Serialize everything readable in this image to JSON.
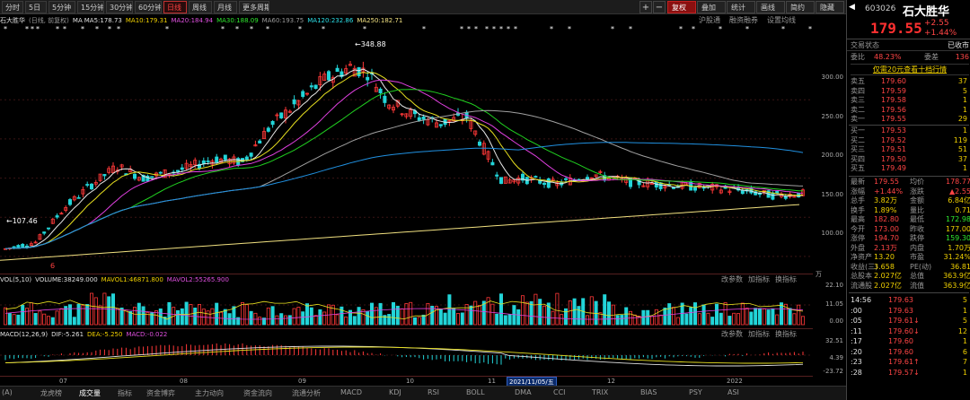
{
  "colors": {
    "up": "#ff3838",
    "down": "#22d4d8",
    "ma5": "#e8e8e8",
    "ma10": "#e8e020",
    "ma20": "#e040e0",
    "ma30": "#20d020",
    "ma60": "#a0a0a0",
    "ma120": "#2090e0",
    "ma250": "#f0e080"
  },
  "toolbar": {
    "periods": [
      "分时",
      "5日",
      "5分钟",
      "15分钟",
      "30分钟",
      "60分钟",
      "日线",
      "周线",
      "月线",
      "更多周期"
    ],
    "active_period": "日线",
    "right": [
      "复权",
      "叠加",
      "统计",
      "画线",
      "简约",
      "隐藏"
    ],
    "active_right": "复权"
  },
  "ma_bar": {
    "title": "石大胜华",
    "sub": "(日线, 前复权)",
    "ma5": "MA5:178.73",
    "ma10": "MA10:179.31",
    "ma20": "MA20:184.94",
    "ma30": "MA30:188.09",
    "ma60": "MA60:193.75",
    "ma120": "MA120:232.86",
    "ma250": "MA250:182.71",
    "links": [
      "沪股通",
      "融资融券",
      "设置均线"
    ]
  },
  "price_chart": {
    "y_ticks": [
      "300.00",
      "250.00",
      "200.00",
      "150.00",
      "100.00"
    ],
    "y_values": [
      300,
      250,
      200,
      150,
      100
    ],
    "high_label": "348.88",
    "low_label": "107.46",
    "ymin": 85,
    "ymax": 385,
    "marker": "6"
  },
  "vol_bar": {
    "title": "VOL(5,10)",
    "volume": "VOLUME:38249.000",
    "mavol1": "MAVOL1:46871.800",
    "mavol2": "MAVOL2:55265.900",
    "links": [
      "改参数",
      "加指标",
      "换指标"
    ],
    "y_ticks": [
      "22.10",
      "11.05",
      "0.00"
    ],
    "unit": "万"
  },
  "macd_bar": {
    "title": "MACD(12,26,9)",
    "dif": "DIF:-5.261",
    "dea": "DEA:-5.250",
    "macd": "MACD:-0.022",
    "links": [
      "改参数",
      "加指标",
      "换指标"
    ],
    "y_ticks": [
      "32.51",
      "4.39",
      "-23.72"
    ]
  },
  "x_axis": {
    "months": [
      "07",
      "08",
      "09",
      "10",
      "11",
      "12",
      "2022"
    ],
    "hover_date": "2021/11/05/五"
  },
  "bottom_tabs": [
    "(A)",
    "龙虎榜",
    "成交量",
    "指标",
    "资金博弈",
    "主力动向",
    "资金流向",
    "流通分析",
    "MACD",
    "KDJ",
    "RSI",
    "BOLL",
    "DMA",
    "CCI",
    "TRIX",
    "BIAS",
    "PSY",
    "ASI"
  ],
  "quote": {
    "code": "603026",
    "name": "石大胜华",
    "price": "179.55",
    "change": "+2.55",
    "change_pct": "+1.44%",
    "trade_status_label": "交易状态",
    "trade_status_value": "已收市",
    "ratio_label": "委比",
    "ratio_value": "48.23%",
    "diff_label": "委差",
    "diff_value": "136",
    "level10": "仅需20元查看十档行情",
    "asks": [
      {
        "label": "卖五",
        "price": "179.60",
        "vol": "37"
      },
      {
        "label": "卖四",
        "price": "179.59",
        "vol": "5"
      },
      {
        "label": "卖三",
        "price": "179.58",
        "vol": "1"
      },
      {
        "label": "卖二",
        "price": "179.56",
        "vol": "1"
      },
      {
        "label": "卖一",
        "price": "179.55",
        "vol": "29"
      }
    ],
    "bids": [
      {
        "label": "买一",
        "price": "179.53",
        "vol": "1"
      },
      {
        "label": "买二",
        "price": "179.52",
        "vol": "119"
      },
      {
        "label": "买三",
        "price": "179.51",
        "vol": "51"
      },
      {
        "label": "买四",
        "price": "179.50",
        "vol": "37"
      },
      {
        "label": "买五",
        "price": "179.49",
        "vol": "1"
      }
    ],
    "stats": [
      {
        "l1": "最新",
        "v1": "179.55",
        "l2": "均价",
        "v2": "178.77"
      },
      {
        "l1": "涨幅",
        "v1": "+1.44%",
        "l2": "涨跌",
        "v2": "▲2.55"
      },
      {
        "l1": "总手",
        "v1": "3.82万",
        "l2": "金额",
        "v2": "6.84亿"
      },
      {
        "l1": "换手",
        "v1": "1.89%",
        "l2": "量比",
        "v2": "0.71"
      },
      {
        "l1": "最高",
        "v1": "182.80",
        "l2": "最低",
        "v2": "172.98"
      },
      {
        "l1": "今开",
        "v1": "173.00",
        "l2": "昨收",
        "v2": "177.00"
      },
      {
        "l1": "涨停",
        "v1": "194.70",
        "l2": "跌停",
        "v2": "159.30"
      },
      {
        "l1": "外盘",
        "v1": "2.13万",
        "l2": "内盘",
        "v2": "1.70万"
      },
      {
        "l1": "净资产",
        "v1": "13.20",
        "l2": "市盈",
        "v2": "31.24%"
      },
      {
        "l1": "收益(三)",
        "v1": "3.658",
        "l2": "PE(动)",
        "v2": "36.81"
      },
      {
        "l1": "总股本",
        "v1": "2.027亿",
        "l2": "总值",
        "v2": "363.9亿"
      },
      {
        "l1": "流通股",
        "v1": "2.027亿",
        "l2": "流值",
        "v2": "363.9亿"
      }
    ],
    "ticks": [
      {
        "t": "14:56",
        "p": "179.63",
        "v": "5"
      },
      {
        "t": ":00",
        "p": "179.63",
        "v": "1"
      },
      {
        "t": ":05",
        "p": "179.61↓",
        "v": "5"
      },
      {
        "t": ":11",
        "p": "179.60↓",
        "v": "12"
      },
      {
        "t": ":17",
        "p": "179.60",
        "v": "1"
      },
      {
        "t": ":20",
        "p": "179.60",
        "v": "6"
      },
      {
        "t": ":23",
        "p": "179.61↑",
        "v": "7"
      },
      {
        "t": ":28",
        "p": "179.57↓",
        "v": "1"
      }
    ]
  }
}
